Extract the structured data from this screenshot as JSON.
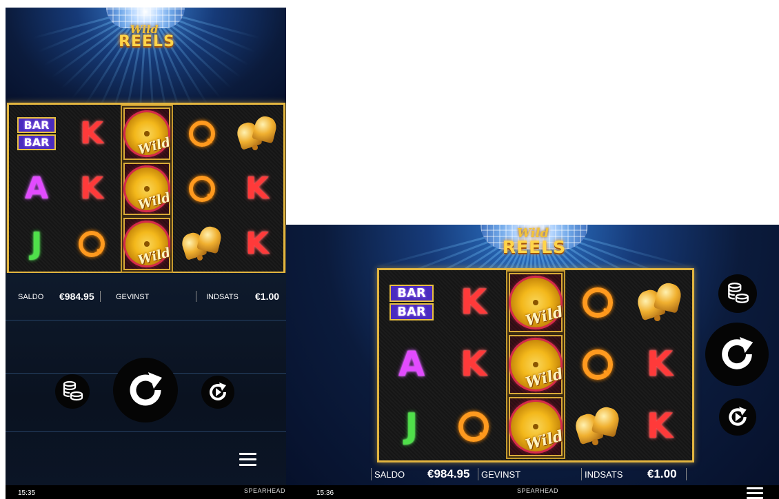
{
  "game": {
    "logo_top": "Wild",
    "logo_bottom": "REELS"
  },
  "grid": {
    "rows": [
      [
        "BAR",
        "K",
        "WILD",
        "Q",
        "BELL"
      ],
      [
        "A",
        "K",
        "WILD",
        "Q",
        "K"
      ],
      [
        "J",
        "Q",
        "WILD",
        "BELL",
        "K"
      ]
    ],
    "bar_text": "BAR",
    "wild_text": "Wild"
  },
  "info": {
    "balance_label": "SALDO",
    "balance_value": "€984.95",
    "win_label": "GEVINST",
    "win_value": "",
    "bet_label": "INDSATS",
    "bet_value": "€1.00"
  },
  "controls": {
    "bet_icon": "coin-stack-icon",
    "spin_icon": "spin-arrow-icon",
    "autoplay_icon": "autoplay-icon",
    "menu_icon": "hamburger-menu-icon"
  },
  "status": {
    "portrait_time": "15:35",
    "landscape_time": "15:36",
    "brand": "SPEARHEAD"
  },
  "colors": {
    "frame_gold": "#e2b540",
    "K": "#ff3a3a",
    "A": "#e24bff",
    "J": "#4fe04a",
    "Q": "#ff9a1f"
  }
}
